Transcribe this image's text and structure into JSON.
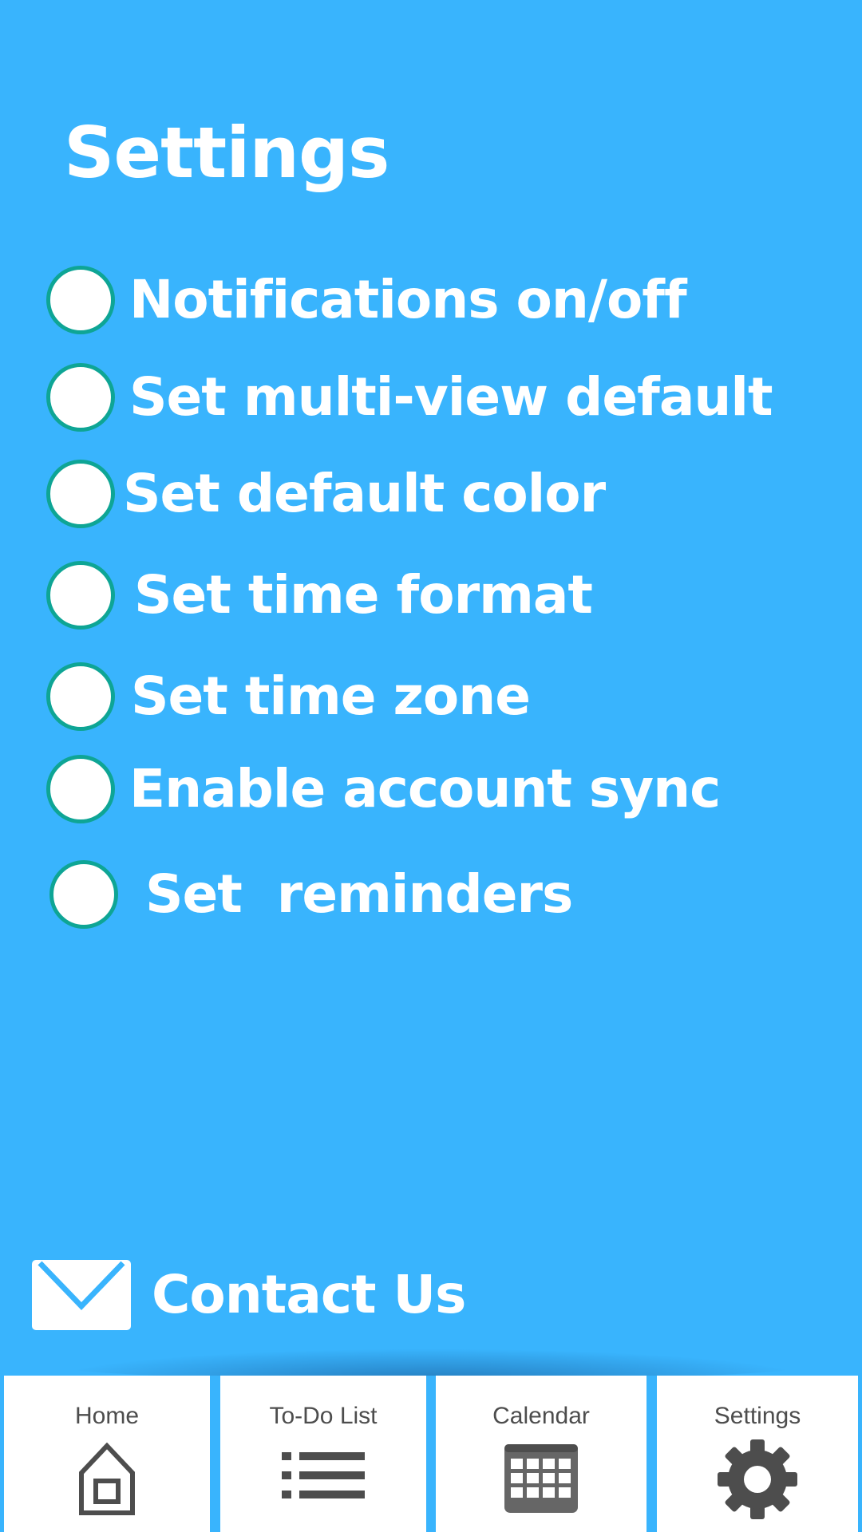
{
  "header": {
    "title": "Settings"
  },
  "settings": {
    "options": [
      {
        "label": "Notifications on/off",
        "selected": false
      },
      {
        "label": "Set multi-view default",
        "selected": false
      },
      {
        "label": "Set default color",
        "selected": false
      },
      {
        "label": "Set time format",
        "selected": false
      },
      {
        "label": "Set time zone",
        "selected": false
      },
      {
        "label": "Enable account sync",
        "selected": false
      },
      {
        "label": "Set  reminders",
        "selected": false
      }
    ]
  },
  "contact": {
    "label": "Contact Us",
    "icon": "envelope-icon"
  },
  "nav": {
    "items": [
      {
        "label": "Home",
        "icon": "home-icon"
      },
      {
        "label": "To-Do List",
        "icon": "list-icon"
      },
      {
        "label": "Calendar",
        "icon": "calendar-icon"
      },
      {
        "label": "Settings",
        "icon": "gear-icon"
      }
    ]
  },
  "colors": {
    "background": "#39b4fd",
    "radio_border": "#0ea595",
    "nav_background": "#ffffff",
    "nav_text": "#4d4d4d",
    "text": "#ffffff"
  }
}
